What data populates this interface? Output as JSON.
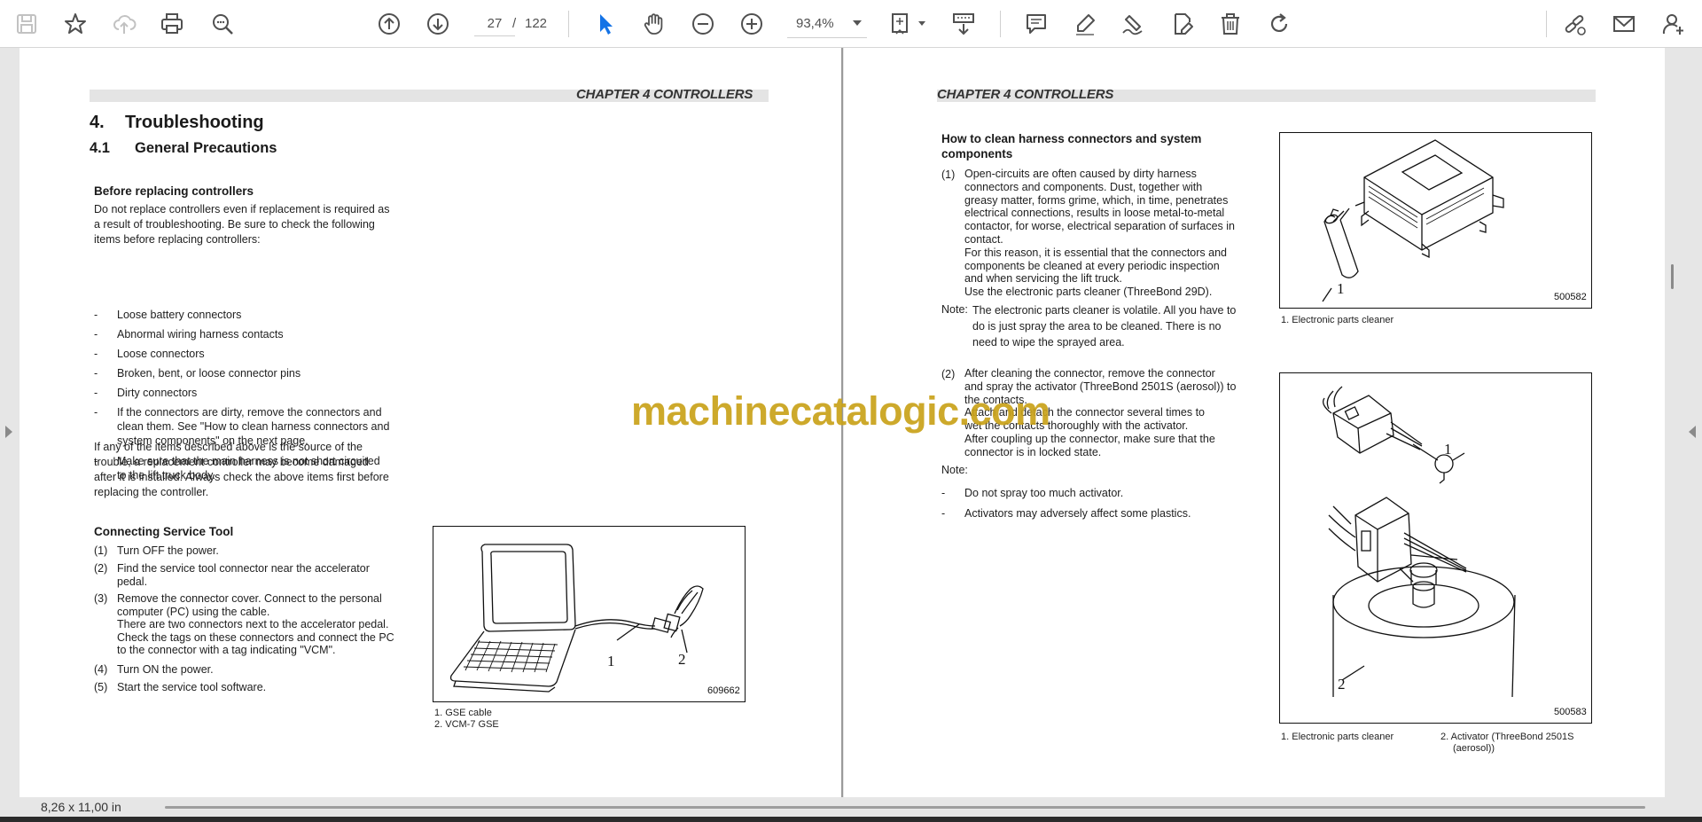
{
  "toolbar": {
    "icons": [
      "save-icon",
      "bookmark-star-icon",
      "cloud-upload-icon",
      "print-icon",
      "zoom-marquee-icon",
      "previous-page-icon",
      "next-page-icon",
      "select-cursor-icon",
      "hand-tool-icon",
      "zoom-out-icon",
      "zoom-in-icon",
      "page-fit-icon",
      "scroll-mode-icon",
      "comment-icon",
      "highlight-pen-icon",
      "sign-pen-icon",
      "edit-pdf-icon",
      "delete-icon",
      "rotate-icon",
      "share-link-icon",
      "email-icon",
      "add-user-icon"
    ],
    "current_page": "27",
    "page_separator": "/",
    "total_pages": "122",
    "zoom": "93,4%",
    "accent": "#1473e6"
  },
  "left_page": {
    "chapter": "CHAPTER 4 CONTROLLERS",
    "h1_num": "4.",
    "h1_text": "Troubleshooting",
    "h2_num": "4.1",
    "h2_text": "General Precautions",
    "sec1_title": "Before replacing controllers",
    "sec1_intro_1": "Do not replace controllers even if replacement is required as",
    "sec1_intro_2": "a result of troubleshooting. Be sure to check the following",
    "sec1_intro_3": "items before replacing controllers:",
    "bullets": [
      {
        "mark": "-",
        "lines": [
          "Loose battery connectors"
        ]
      },
      {
        "mark": "-",
        "lines": [
          "Abnormal wiring harness contacts"
        ]
      },
      {
        "mark": "-",
        "lines": [
          "Loose connectors"
        ]
      },
      {
        "mark": "-",
        "lines": [
          "Broken, bent, or loose connector pins"
        ]
      },
      {
        "mark": "-",
        "lines": [
          "Dirty connectors"
        ]
      },
      {
        "mark": "-",
        "lines": [
          "If the connectors are dirty, remove the connectors and",
          "clean them. See \"How to clean harness connectors and",
          "system components\" on the next page."
        ]
      },
      {
        "mark": "-",
        "lines": [
          "Make sure that the main harness is not short circuited",
          "to the lift truck body."
        ]
      }
    ],
    "sec1_outro": [
      "If any of the items described above is the source of the",
      "trouble, a replacement controller may become damaged",
      "after it is installed. Always check the above items first before",
      "replacing the controller."
    ],
    "sec2_title": "Connecting Service Tool",
    "steps": [
      {
        "mark": "(1)",
        "lines": [
          "Turn OFF the power."
        ]
      },
      {
        "mark": "(2)",
        "lines": [
          "Find the service tool connector near the accelerator",
          "pedal."
        ]
      },
      {
        "mark": "(3)",
        "lines": [
          "Remove the connector cover. Connect to the personal",
          "computer (PC) using the cable.",
          "There are two connectors next to the accelerator pedal.",
          "Check the tags on these connectors and connect the PC",
          "to the connector with a tag indicating \"VCM\"."
        ]
      },
      {
        "mark": "(4)",
        "lines": [
          "Turn ON the power."
        ]
      },
      {
        "mark": "(5)",
        "lines": [
          "Start the service tool software."
        ]
      }
    ],
    "fig1_number": "609662",
    "fig1_callout_1": "1",
    "fig1_callout_2": "2",
    "fig1_captions": [
      "1.  GSE cable",
      "2.  VCM-7 GSE"
    ]
  },
  "right_page": {
    "chapter": "CHAPTER 4 CONTROLLERS",
    "sec_title_1": "How to clean harness connectors and system",
    "sec_title_2": "components",
    "item1_mark": "(1)",
    "item1_lines": [
      "Open-circuits are often caused by dirty harness",
      "connectors and components. Dust, together with",
      "greasy matter, forms grime, which, in time, penetrates",
      "electrical connections, results in loose metal-to-metal",
      "contactor, for worse, electrical separation of surfaces in",
      "contact.",
      "For this reason, it is essential that the connectors and",
      "components be cleaned at every periodic inspection",
      "and when servicing the lift truck.",
      "Use the electronic parts cleaner (ThreeBond 29D)."
    ],
    "note1_label": "Note:",
    "note1_lines": [
      "The electronic parts cleaner is volatile. All you have to",
      "do is just spray the area to be cleaned. There is no",
      "need to wipe the sprayed area."
    ],
    "item2_mark": "(2)",
    "item2_lines": [
      "After cleaning the connector, remove the connector",
      "and spray the activator (ThreeBond 2501S (aerosol)) to",
      "the contacts.",
      "Attach and detach the connector several times to",
      "wet the contacts thoroughly with the activator.",
      "After coupling up the connector, make sure that the",
      "connector is in locked state."
    ],
    "note2_label": "Note:",
    "note2_bullets": [
      {
        "mark": "-",
        "text": "Do not spray too much activator."
      },
      {
        "mark": "-",
        "text": "Activators may adversely affect some plastics."
      }
    ],
    "fig2_number": "500582",
    "fig2_callout": "1",
    "fig2_caption": "1.  Electronic parts cleaner",
    "fig3_number": "500583",
    "fig3_callout_1": "1",
    "fig3_callout_2": "2",
    "fig3_caption_1": "1.  Electronic parts cleaner",
    "fig3_caption_2a": "2.  Activator (ThreeBond 2501S",
    "fig3_caption_2b": "(aerosol))"
  },
  "watermark": "machinecatalogic.com",
  "status": {
    "page_size": "8,26 x 11,00 in"
  }
}
